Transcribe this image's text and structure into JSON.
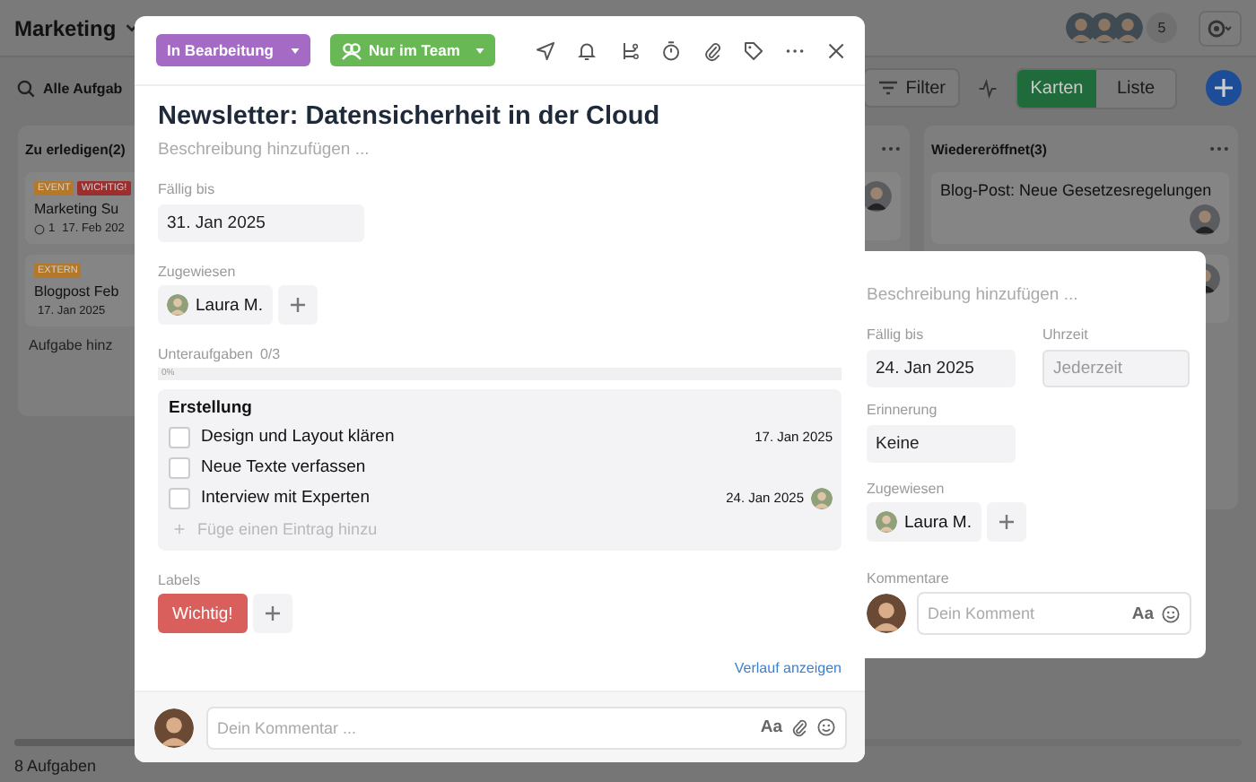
{
  "header": {
    "title": "Marketing",
    "member_count": "5"
  },
  "toolbar": {
    "search_label": "Alle Aufgab",
    "filter": "Filter",
    "views": [
      {
        "label": "Karten",
        "selected": true
      },
      {
        "label": "Liste",
        "selected": false
      }
    ]
  },
  "columns": [
    {
      "title": "Zu erledigen(2)",
      "add_label": "Aufgabe hinz",
      "cards": [
        {
          "tags": [
            {
              "label": "EVENT",
              "color": "#b3782a"
            },
            {
              "label": "WICHTIG!",
              "color": "#9c2e2e"
            }
          ],
          "title": "Marketing Su",
          "comments": "1",
          "date": "17. Feb 202"
        },
        {
          "tags": [
            {
              "label": "EXTERN",
              "color": "#b3782a"
            }
          ],
          "title": "Blogpost Feb",
          "date": "17. Jan 2025"
        }
      ]
    },
    {
      "cards": [
        {
          "assignee": true
        }
      ]
    },
    {
      "title": "Wiedereröffnet(3)",
      "cards": [
        {
          "title": "Blog-Post: Neue Gesetzesregelungen",
          "assignee": true
        },
        {
          "assignee": true
        }
      ]
    }
  ],
  "footer": {
    "count": "8 Aufgaben"
  },
  "task": {
    "status": {
      "label": "In Bearbeitung"
    },
    "visibility": {
      "label": "Nur im Team"
    },
    "title": "Newsletter: Datensicherheit in der Cloud",
    "description_placeholder": "Beschreibung hinzufügen ...",
    "due": {
      "label": "Fällig bis",
      "value": "31. Jan 2025"
    },
    "assigned": {
      "label": "Zugewiesen",
      "people": [
        "Laura M."
      ]
    },
    "subtasks": {
      "label": "Unteraufgaben",
      "count": "0/3",
      "progress": {
        "level": 0,
        "reading": "0%"
      },
      "group": "Erstellung",
      "add_placeholder": "Füge einen Eintrag hinzu",
      "items": [
        {
          "text": "Design und Layout klären",
          "checked": false,
          "date": "17. Jan 2025"
        },
        {
          "text": "Neue Texte verfassen",
          "checked": false
        },
        {
          "text": "Interview mit Experten",
          "checked": false,
          "date": "24. Jan 2025",
          "assignee": true
        }
      ]
    },
    "labels": {
      "label": "Labels",
      "items": [
        {
          "label": "Wichtig!",
          "color": "#d95f5c"
        }
      ]
    },
    "history_link": "Verlauf anzeigen",
    "comment": {
      "placeholder": "Dein Kommentar ...",
      "format": "Aa"
    }
  },
  "popover": {
    "description_placeholder": "Beschreibung hinzufügen ...",
    "due": {
      "label": "Fällig bis",
      "value": "24. Jan 2025"
    },
    "time": {
      "label": "Uhrzeit",
      "placeholder": "Jederzeit"
    },
    "reminder": {
      "label": "Erinnerung",
      "value": "Keine"
    },
    "assigned": {
      "label": "Zugewiesen",
      "people": [
        "Laura M."
      ]
    },
    "comments": {
      "label": "Kommentare",
      "placeholder": "Dein Komment",
      "format": "Aa"
    }
  }
}
